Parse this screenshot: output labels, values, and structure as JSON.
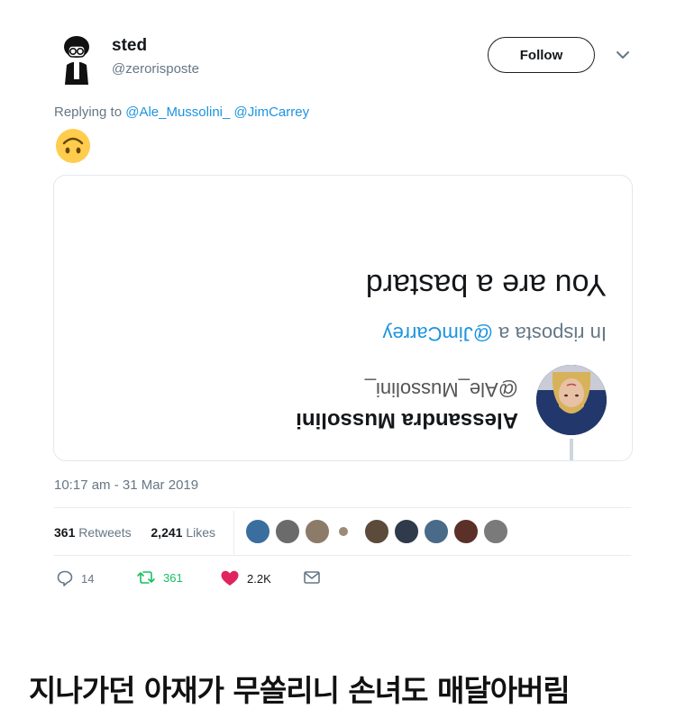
{
  "tweet": {
    "display_name": "sted",
    "handle": "@zerorisposte",
    "follow_label": "Follow",
    "replying_to_prefix": "Replying to",
    "replying_to_mentions": [
      "@Ale_Mussolini_",
      "@JimCarrey"
    ],
    "emoji": "upside-down-face",
    "timestamp": "10:17 am - 31 Mar 2019",
    "retweets_count": "361",
    "retweets_label": "Retweets",
    "likes_count": "2,241",
    "likes_label": "Likes",
    "actions": {
      "reply_count": "14",
      "retweet_count": "361",
      "like_count": "2.2K"
    }
  },
  "quoted": {
    "display_name": "Alessandra Mussolini",
    "handle": "@Ale_Mussolini_",
    "reply_prefix": "In risposta a",
    "reply_mention": "@JimCarrey",
    "text": "You are a bastard"
  },
  "caption": "지나가던 아재가 무쏠리니 손녀도 매달아버림",
  "colors": {
    "link": "#1c94e0",
    "retweet": "#17bf63",
    "like": "#e0245e",
    "muted": "#657786"
  }
}
